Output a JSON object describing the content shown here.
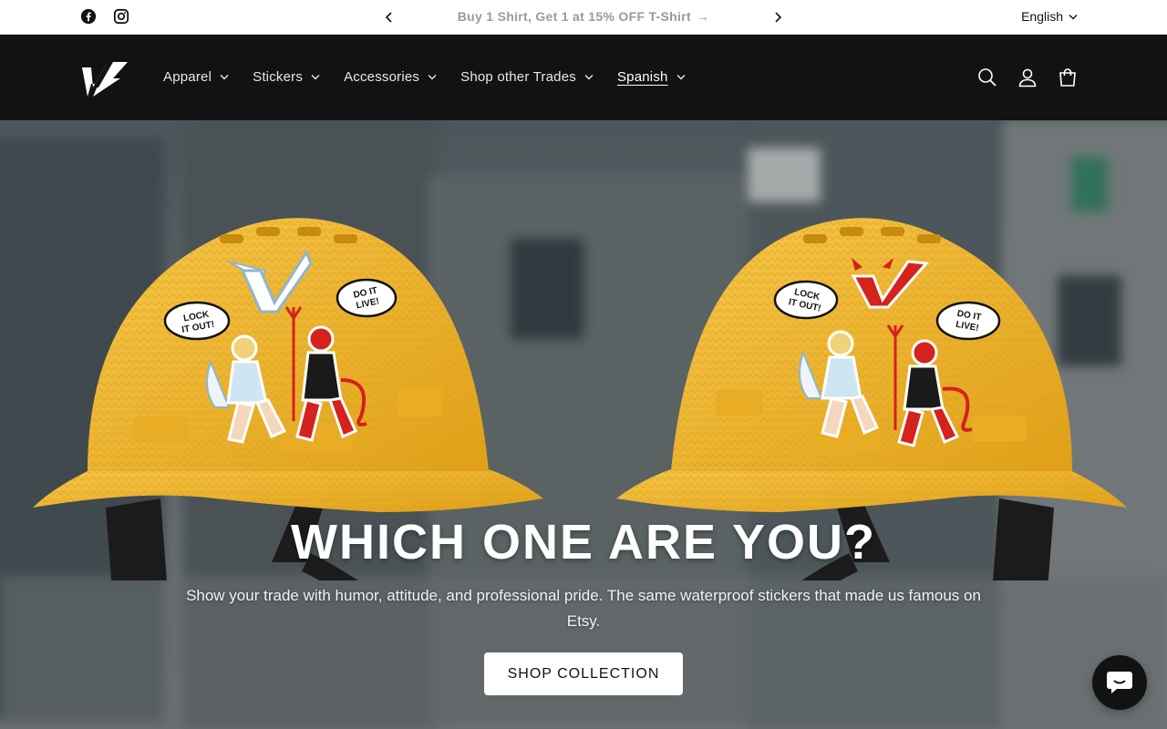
{
  "announcement": {
    "text": "Buy 1 Shirt, Get 1 at 15% OFF T-Shirt",
    "arrow": "→",
    "prev_icon": "chevron-left-icon",
    "next_icon": "chevron-right-icon"
  },
  "social": [
    "facebook-icon",
    "instagram-icon"
  ],
  "language": {
    "selected": "English"
  },
  "nav": {
    "items": [
      {
        "label": "Apparel"
      },
      {
        "label": "Stickers"
      },
      {
        "label": "Accessories"
      },
      {
        "label": "Shop other Trades"
      },
      {
        "label": "Spanish"
      }
    ]
  },
  "header_icons": [
    "search-icon",
    "account-icon",
    "cart-icon"
  ],
  "hero": {
    "title": "WHICH ONE ARE YOU?",
    "subtitle": "Show your trade with humor, attitude, and professional pride. The same waterproof stickers that made us famous on Etsy.",
    "button": "SHOP COLLECTION",
    "stickers": {
      "bubble_left": "LOCK IT OUT!",
      "bubble_right": "DO IT LIVE!"
    }
  },
  "colors": {
    "header_bg": "#121212",
    "helmet_yellow": "#f2b52a",
    "announcement_text": "#9a9a9a"
  }
}
